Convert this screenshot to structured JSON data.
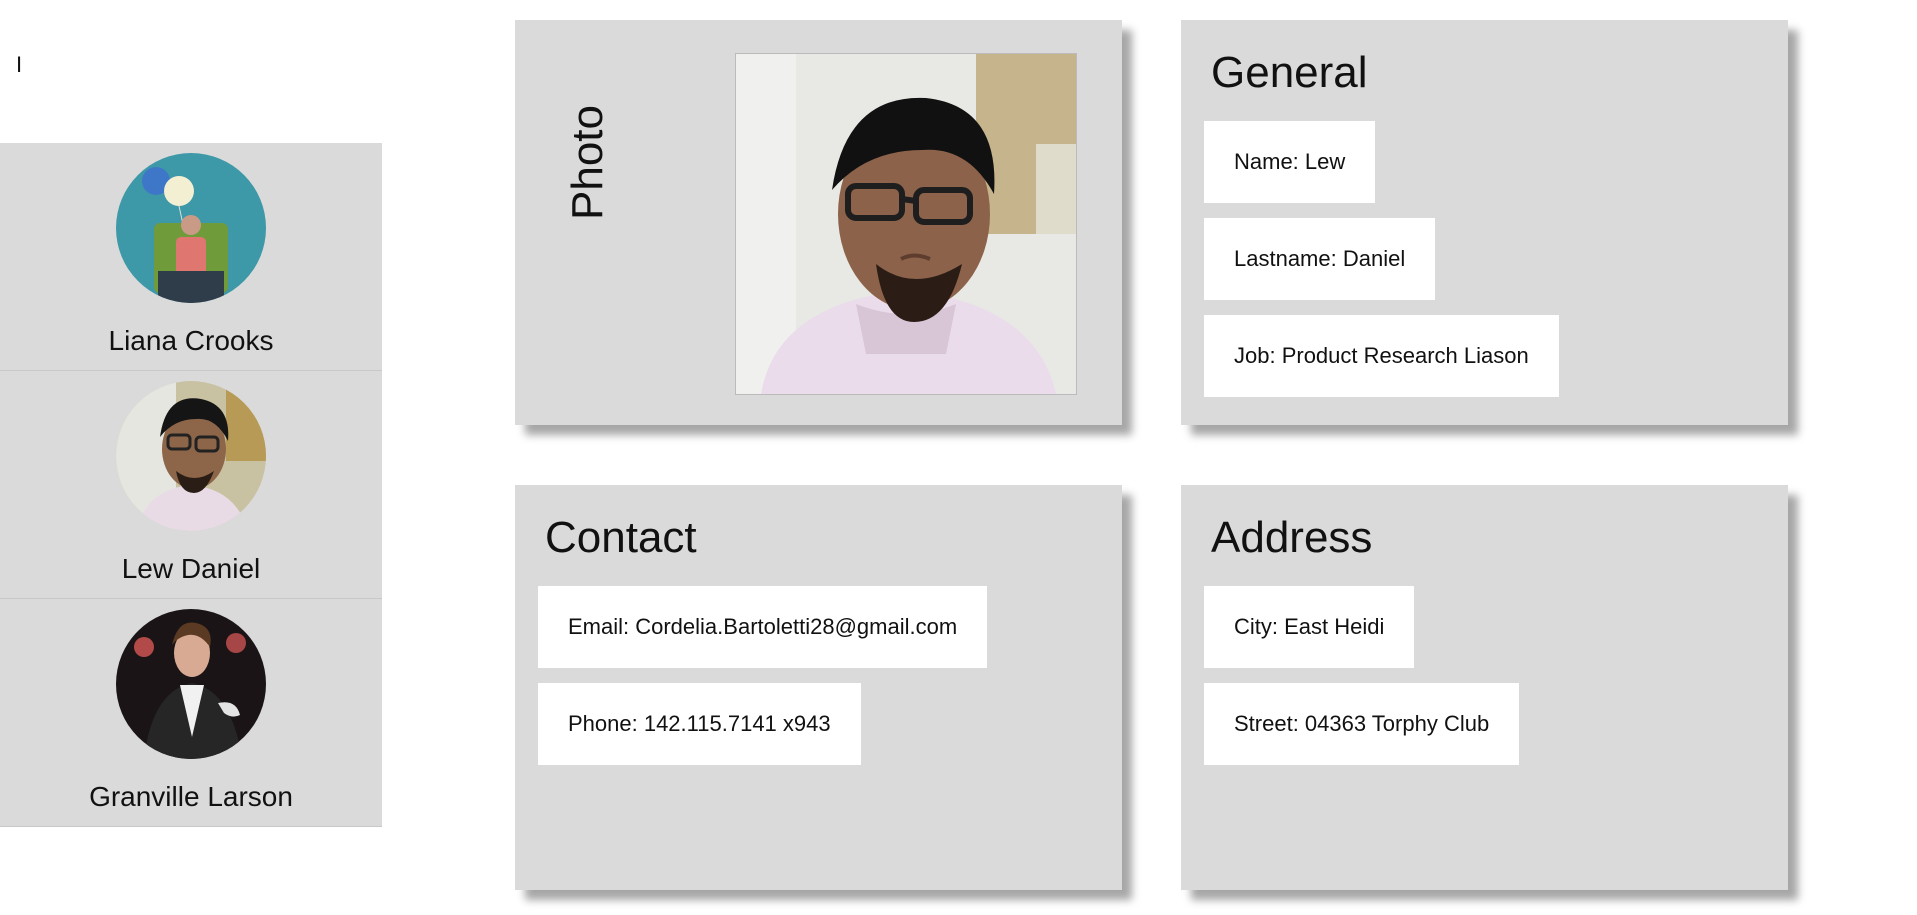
{
  "search": {
    "value": "I"
  },
  "contacts": [
    {
      "name": "Liana Crooks",
      "avatar_icon": "person-avatar-photo"
    },
    {
      "name": "Lew Daniel",
      "avatar_icon": "person-avatar-photo"
    },
    {
      "name": "Granville Larson",
      "avatar_icon": "person-avatar-photo"
    }
  ],
  "photo_card": {
    "label": "Photo"
  },
  "general_card": {
    "title": "General",
    "name": "Name: Lew",
    "lastname": "Lastname: Daniel",
    "job": "Job: Product Research Liason"
  },
  "contact_card": {
    "title": "Contact",
    "email": "Email: Cordelia.Bartoletti28@gmail.com",
    "phone": "Phone: 142.115.7141 x943"
  },
  "address_card": {
    "title": "Address",
    "city": "City: East Heidi",
    "street": "Street: 04363 Torphy Club"
  },
  "colors": {
    "card_bg": "#dadada",
    "field_bg": "#ffffff",
    "text": "#111111"
  }
}
